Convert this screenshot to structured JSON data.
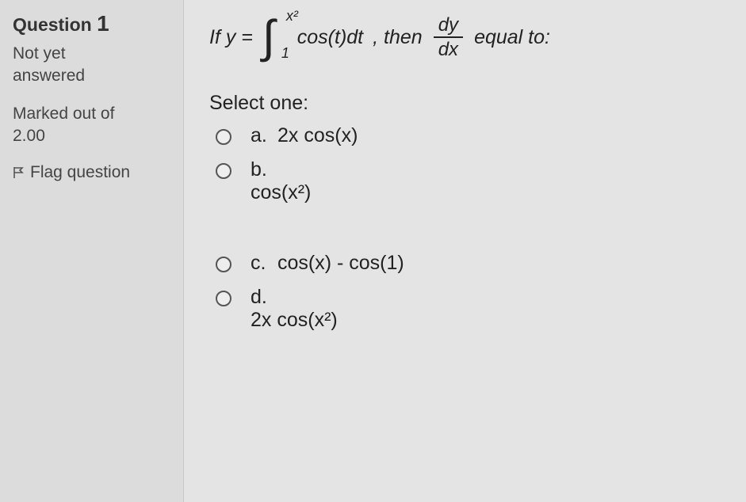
{
  "sidebar": {
    "question_label": "Question",
    "question_number": "1",
    "status_line1": "Not yet",
    "status_line2": "answered",
    "marked_line1": "Marked out of",
    "marked_line2": "2.00",
    "flag_label": "Flag question"
  },
  "question": {
    "prefix": "If y =",
    "integral_lower": "1",
    "integral_upper": "x²",
    "integrand": "cos(t)dt",
    "mid": ", then",
    "frac_num": "dy",
    "frac_den": "dx",
    "suffix": "equal to:"
  },
  "select_label": "Select one:",
  "options": {
    "a": {
      "letter": "a.",
      "text": "2x cos(x)"
    },
    "b": {
      "letter": "b.",
      "text": "cos(x²)"
    },
    "c": {
      "letter": "c.",
      "text": "cos(x) - cos(1)"
    },
    "d": {
      "letter": "d.",
      "text": "2x cos(x²)"
    }
  }
}
